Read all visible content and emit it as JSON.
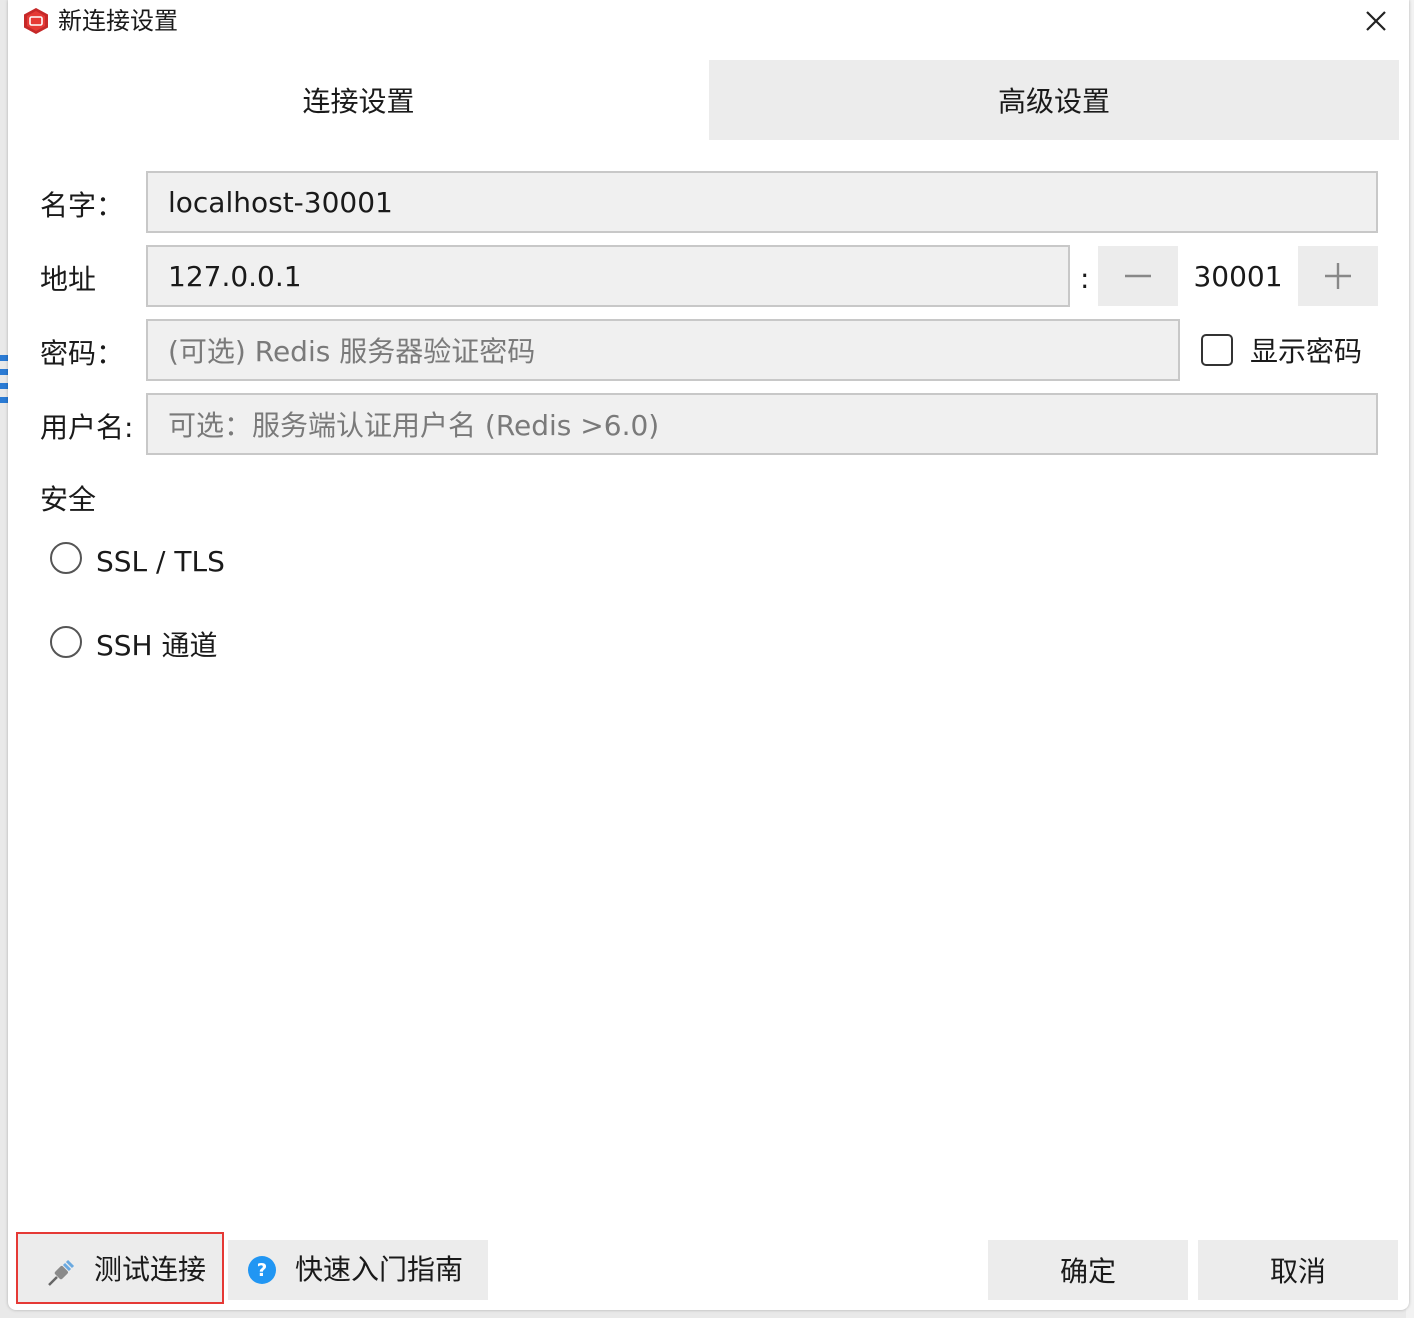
{
  "window": {
    "title": "新连接设置"
  },
  "tabs": [
    {
      "label": "连接设置",
      "active": true
    },
    {
      "label": "高级设置",
      "active": false
    }
  ],
  "form": {
    "name": {
      "label": "名字：",
      "value": "localhost-30001"
    },
    "address": {
      "label": "地址",
      "value": "127.0.0.1",
      "separator": ":"
    },
    "port": {
      "value": "30001"
    },
    "password": {
      "label": "密码：",
      "placeholder": "(可选) Redis 服务器验证密码",
      "show_password_label": "显示密码"
    },
    "username": {
      "label": "用户名:",
      "placeholder": "可选：服务端认证用户名 (Redis >6.0)"
    }
  },
  "security": {
    "title": "安全",
    "options": [
      {
        "label": "SSL / TLS"
      },
      {
        "label": "SSH 通道"
      }
    ]
  },
  "footer": {
    "test_label": "测试连接",
    "guide_label": "快速入门指南",
    "ok_label": "确定",
    "cancel_label": "取消"
  },
  "colors": {
    "highlight_border": "#e53935",
    "help_icon": "#2196f3",
    "app_icon": "#c62828"
  }
}
